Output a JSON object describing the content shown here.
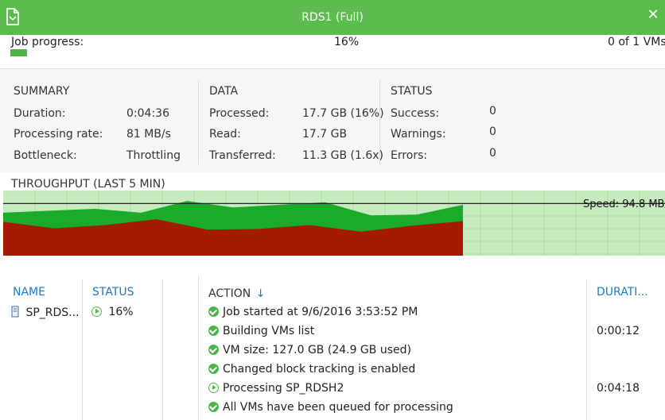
{
  "title": "RDS1 (Full)",
  "progress": {
    "label": "Job progress:",
    "percent_text": "16%",
    "percent": 16,
    "count_text": "0 of 1 VMs"
  },
  "summary": {
    "heading": "SUMMARY",
    "rows": [
      {
        "label": "Duration:",
        "value": "0:04:36"
      },
      {
        "label": "Processing rate:",
        "value": "81 MB/s"
      },
      {
        "label": "Bottleneck:",
        "value": "Throttling"
      }
    ]
  },
  "data": {
    "heading": "DATA",
    "rows": [
      {
        "label": "Processed:",
        "value": "17.7 GB (16%)"
      },
      {
        "label": "Read:",
        "value": "17.7 GB"
      },
      {
        "label": "Transferred:",
        "value": "11.3 GB (1.6x)"
      }
    ]
  },
  "status": {
    "heading": "STATUS",
    "rows": [
      {
        "label": "Success:",
        "value": "0"
      },
      {
        "label": "Warnings:",
        "value": "0"
      },
      {
        "label": "Errors:",
        "value": "0"
      }
    ]
  },
  "throughput": {
    "title": "THROUGHPUT (LAST 5 MIN)",
    "speed_label": "Speed: 94.8 MB/s",
    "colors": {
      "read": "#1aab2a",
      "transferred": "#a31b00",
      "bg": "#c6ebbf",
      "grid": "#b0dca7",
      "line": "#222222"
    },
    "read_series": [
      66,
      69,
      72,
      66,
      84,
      74,
      78,
      82,
      62,
      63,
      78
    ],
    "transferred_series": [
      52,
      42,
      47,
      56,
      40,
      41,
      47,
      37,
      46,
      53
    ],
    "speed_line": 80
  },
  "vm_list": {
    "headers": {
      "name": "NAME",
      "status": "STATUS"
    },
    "rows": [
      {
        "name": "SP_RDS...",
        "status": "16%"
      }
    ]
  },
  "actions": {
    "headers": {
      "action": "ACTION",
      "sort_arrow": "↓",
      "duration": "DURATI..."
    },
    "rows": [
      {
        "icon": "check-icon",
        "text": "Job started at 9/6/2016 3:53:52 PM",
        "duration": ""
      },
      {
        "icon": "check-icon",
        "text": "Building VMs list",
        "duration": "0:00:12"
      },
      {
        "icon": "check-icon",
        "text": "VM size: 127.0 GB (24.9 GB used)",
        "duration": ""
      },
      {
        "icon": "check-icon",
        "text": "Changed block tracking is enabled",
        "duration": ""
      },
      {
        "icon": "play-icon",
        "text": "Processing SP_RDSH2",
        "duration": "0:04:18"
      },
      {
        "icon": "check-icon",
        "text": "All VMs have been queued for processing",
        "duration": ""
      }
    ]
  }
}
